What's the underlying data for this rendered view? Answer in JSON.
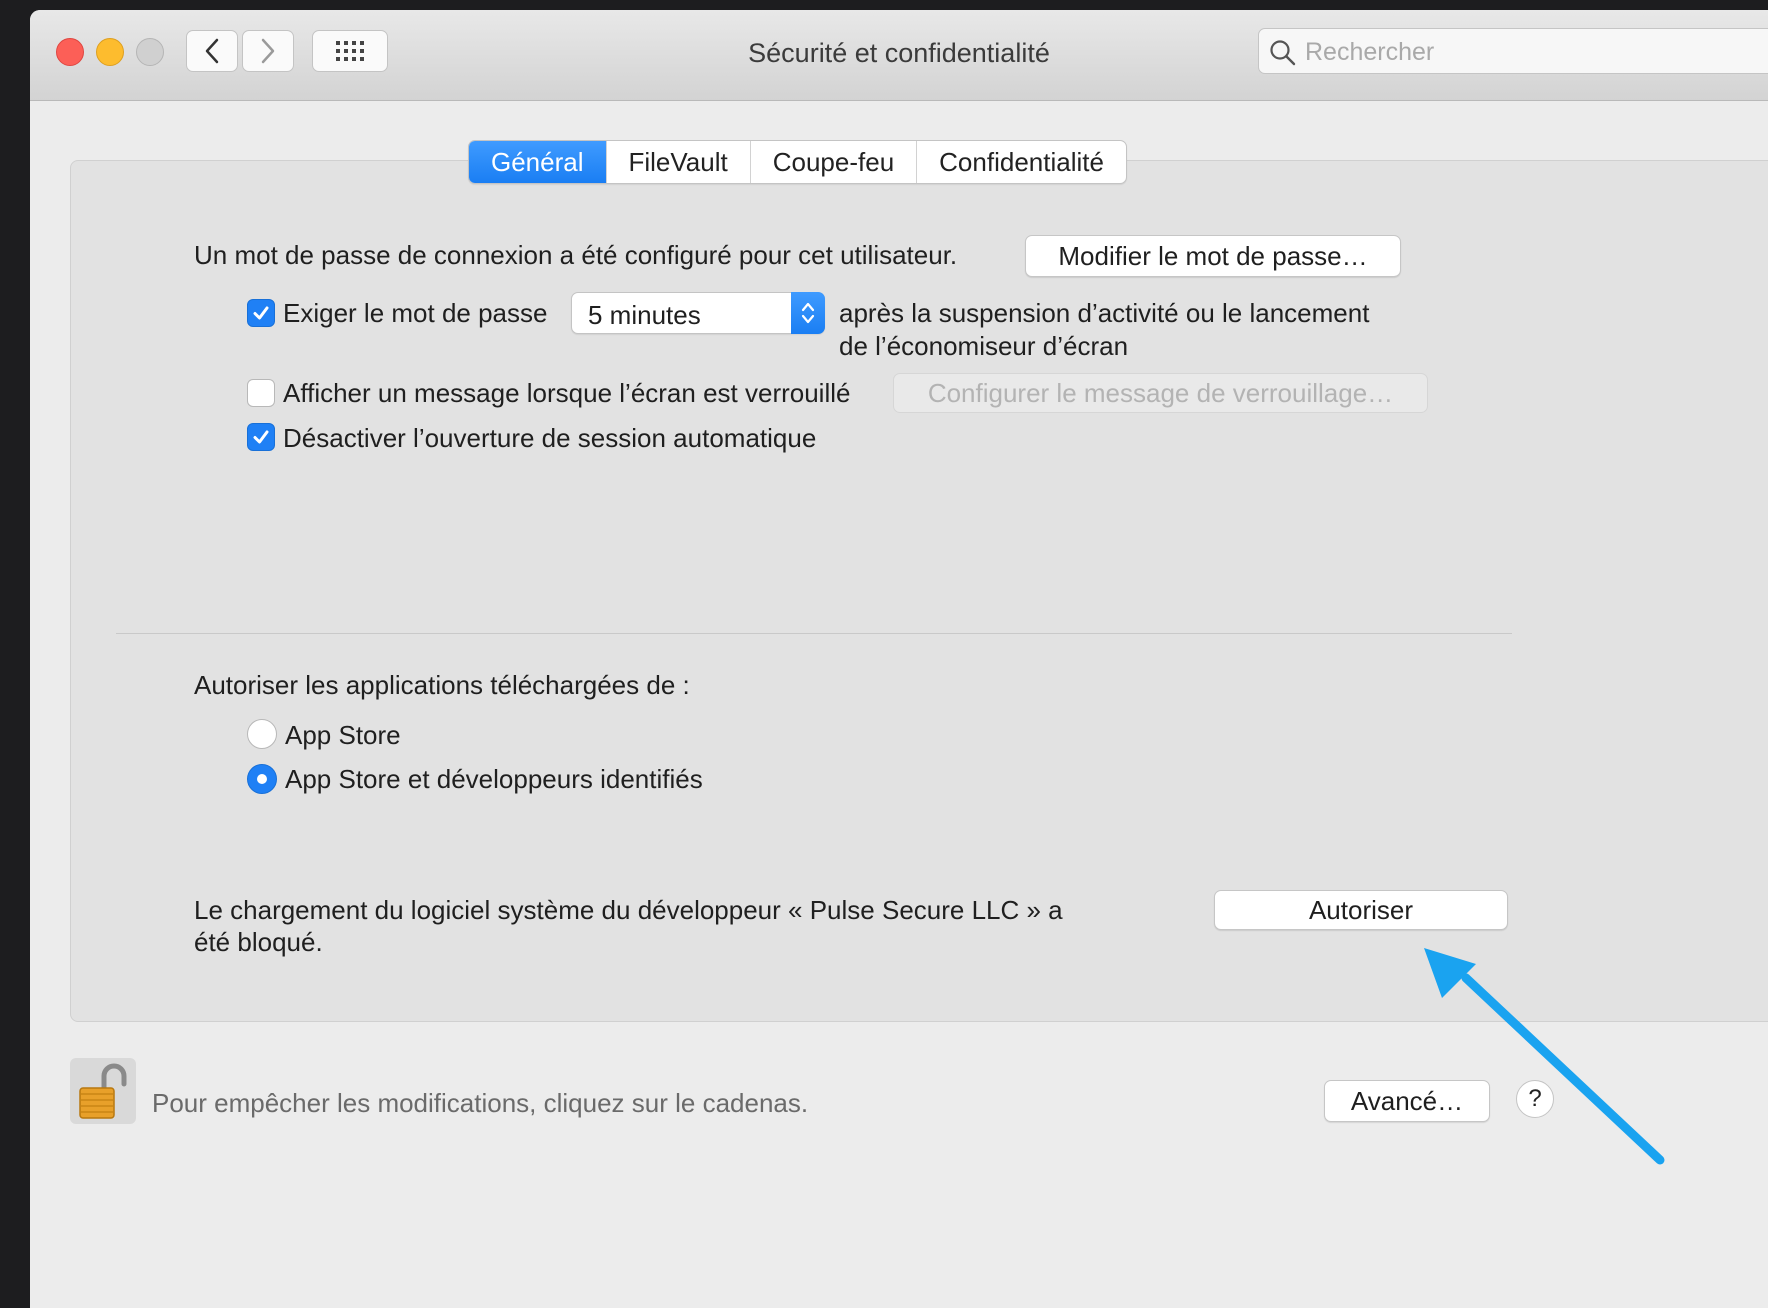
{
  "window": {
    "title": "Sécurité et confidentialité",
    "search_placeholder": "Rechercher"
  },
  "tabs": [
    {
      "label": "Général",
      "active": true
    },
    {
      "label": "FileVault",
      "active": false
    },
    {
      "label": "Coupe-feu",
      "active": false
    },
    {
      "label": "Confidentialité",
      "active": false
    }
  ],
  "general": {
    "password_text": "Un mot de passe de connexion a été configuré pour cet utilisateur.",
    "change_password_button": "Modifier le mot de passe…",
    "require_password": {
      "label": "Exiger le mot de passe",
      "checked": true,
      "delay_value": "5 minutes",
      "suffix_line1": "après la suspension d’activité ou le lancement",
      "suffix_line2": "de l’économiseur d’écran"
    },
    "show_message": {
      "label": "Afficher un message lorsque l’écran est verrouillé",
      "checked": false,
      "button": "Configurer le message de verrouillage…"
    },
    "disable_autologin": {
      "label": "Désactiver l’ouverture de session automatique",
      "checked": true
    }
  },
  "downloads": {
    "heading": "Autoriser les applications téléchargées de :",
    "options": [
      {
        "label": "App Store",
        "selected": false
      },
      {
        "label": "App Store et développeurs identifiés",
        "selected": true
      }
    ]
  },
  "blocked": {
    "line1": "Le chargement du logiciel système du développeur « Pulse Secure LLC » a",
    "line2": "été bloqué.",
    "allow_button": "Autoriser"
  },
  "footer": {
    "lock_text": "Pour empêcher les modifications, cliquez sur le cadenas.",
    "advanced_button": "Avancé…",
    "help_label": "?"
  },
  "colors": {
    "accent": "#1f80f5",
    "annotation_arrow": "#1aa3f0"
  }
}
